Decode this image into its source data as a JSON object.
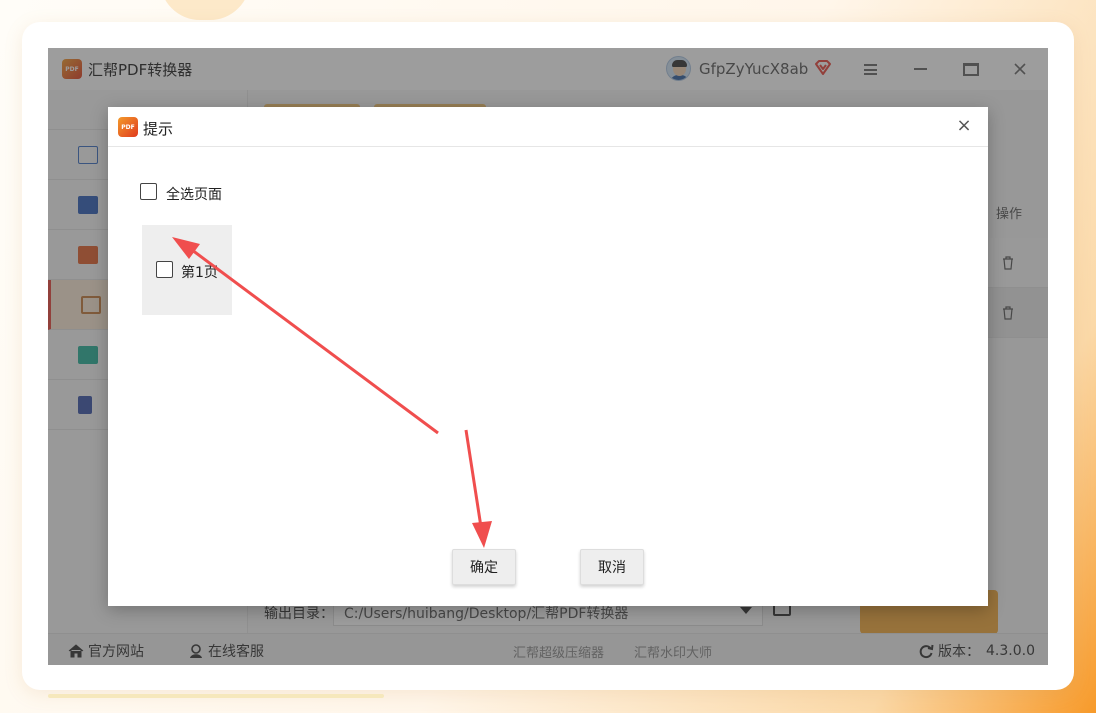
{
  "app": {
    "title": "汇帮PDF转换器",
    "logo_text": "PDF",
    "username": "GfpZyYucX8ab"
  },
  "main": {
    "ops_header": "操作",
    "output_label": "输出目录：",
    "output_path": "C:/Users/huibang/Desktop/汇帮PDF转换器"
  },
  "statusbar": {
    "official_site": "官方网站",
    "online_service": "在线客服",
    "link_compressor": "汇帮超级压缩器",
    "link_watermark": "汇帮水印大师",
    "version_label": "版本：",
    "version_value": "4.3.0.0"
  },
  "dialog": {
    "title": "提示",
    "close_glyph": "×",
    "select_all_label": "全选页面",
    "pages": [
      {
        "label": "第1页",
        "checked": false
      }
    ],
    "ok_label": "确定",
    "cancel_label": "取消"
  },
  "colors": {
    "accent": "#f2a93a",
    "brand_red": "#e8443a",
    "arrow": "#f04e4e",
    "vip": "#e8443a"
  },
  "icons": [
    "word-icon",
    "excel-icon",
    "ppt-icon",
    "image-icon",
    "txt-icon",
    "other-icon",
    "trash-icon",
    "home-icon",
    "service-icon",
    "refresh-icon",
    "vip-diamond-icon",
    "close-icon"
  ]
}
